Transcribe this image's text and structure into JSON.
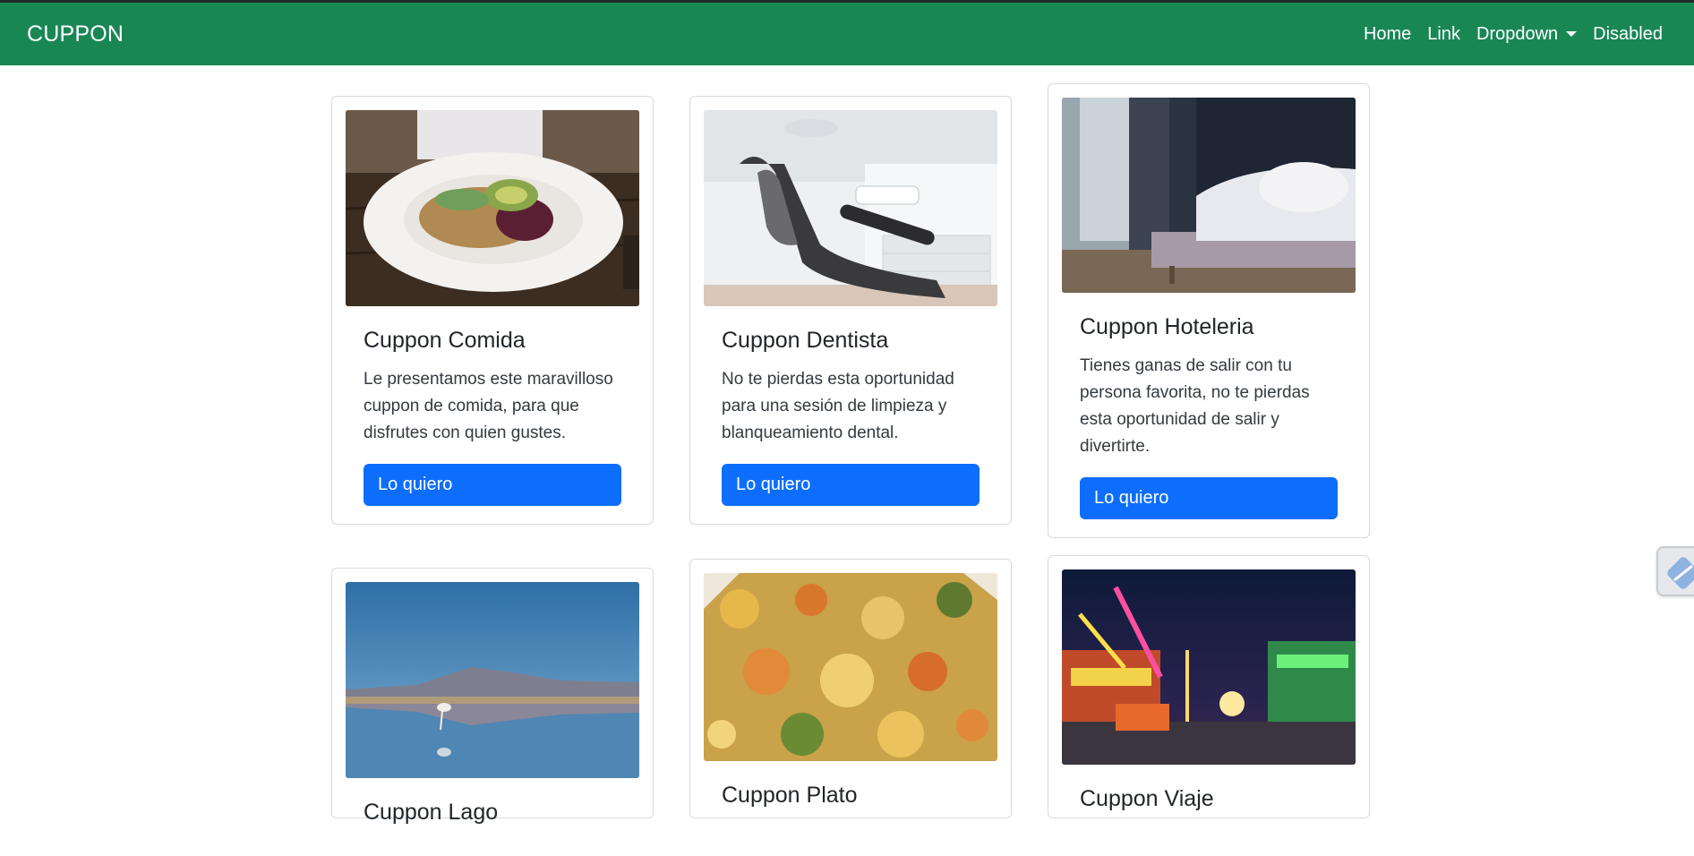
{
  "navbar": {
    "brand": "CUPPON",
    "links": [
      {
        "label": "Home"
      },
      {
        "label": "Link"
      },
      {
        "label": "Dropdown"
      },
      {
        "label": "Disabled"
      }
    ]
  },
  "colors": {
    "navbar": "#198754",
    "button": "#0d6efd"
  },
  "cards": [
    {
      "title": "Cuppon Comida",
      "text": "Le presentamos este maravilloso cuppon de comida, para que disfrutes con quien gustes.",
      "button": "Lo quiero",
      "image": "food-salad-photo"
    },
    {
      "title": "Cuppon Dentista",
      "text": "No te pierdas esta oportunidad para una sesión de limpieza y blanqueamiento dental.",
      "button": "Lo quiero",
      "image": "dental-chair-photo"
    },
    {
      "title": "Cuppon Hoteleria",
      "text": "Tienes ganas de salir con tu persona favorita, no te pierdas esta oportunidad de salir y divertirte.",
      "button": "Lo quiero",
      "image": "hotel-bed-photo"
    },
    {
      "title": "Cuppon Lago",
      "image": "lake-flamingo-photo"
    },
    {
      "title": "Cuppon Plato",
      "image": "rice-dish-photo"
    },
    {
      "title": "Cuppon Viaje",
      "image": "fairground-night-photo"
    }
  ]
}
